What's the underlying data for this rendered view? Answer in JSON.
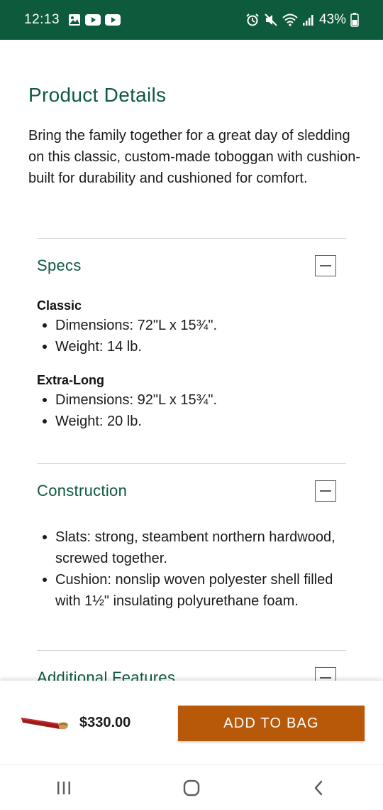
{
  "status_bar": {
    "time": "12:13",
    "battery": "43%",
    "left_icons": [
      "gallery-icon",
      "youtube-icon",
      "youtube-icon"
    ],
    "right_icons": [
      "alarm-icon",
      "mute-icon",
      "wifi-icon",
      "signal-icon",
      "battery-icon"
    ],
    "background": "#0e5a3c"
  },
  "product": {
    "title": "Product Details",
    "description": "Bring the family together for a great day of sledding on this classic, custom-made toboggan with cushion-built for durability and cushioned for comfort."
  },
  "sections": {
    "specs": {
      "title": "Specs",
      "groups": [
        {
          "name": "Classic",
          "items": [
            "Dimensions: 72\"L x 15¾\".",
            "Weight: 14 lb."
          ]
        },
        {
          "name": "Extra-Long",
          "items": [
            "Dimensions: 92\"L x 15¾\".",
            "Weight: 20 lb."
          ]
        }
      ]
    },
    "construction": {
      "title": "Construction",
      "items": [
        "Slats: strong, steambent northern hardwood, screwed together.",
        "Cushion: nonslip woven polyester shell filled with 1½\" insulating polyurethane foam."
      ]
    },
    "additional": {
      "title": "Additional Features"
    }
  },
  "purchase_bar": {
    "price": "$330.00",
    "add_button_label": "ADD TO BAG",
    "button_color": "#b8590a"
  },
  "nav_bar": {
    "buttons": [
      "recents-icon",
      "home-icon",
      "back-icon"
    ]
  },
  "colors": {
    "accent_green": "#0e5a3c",
    "accent_orange": "#b8590a"
  }
}
